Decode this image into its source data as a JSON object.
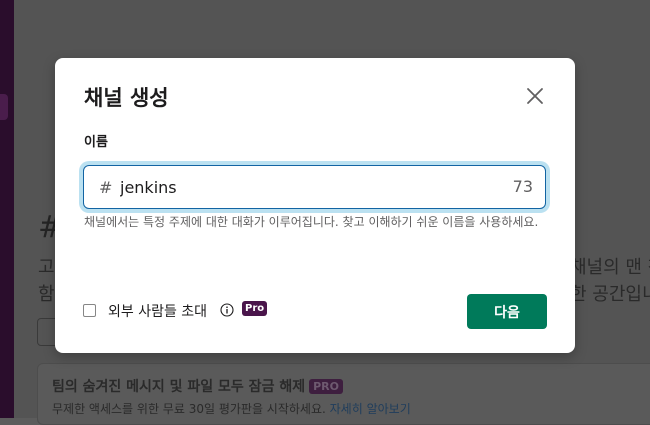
{
  "background": {
    "hash_glyph": "#",
    "left_line_1": "고",
    "left_line_2": "함",
    "right_line_1": "채널의 맨 첫",
    "right_line_2": "한 공간입니",
    "banner": {
      "title": "팀의 숨겨진 메시지 및 파일 모두 잠금 해제",
      "badge": "PRO",
      "subtitle": "무제한 액세스를 위한 무료 30일 평가판을 시작하세요.",
      "link": "자세히 알아보기"
    }
  },
  "modal": {
    "title": "채널 생성",
    "name_label": "이름",
    "prefix": "#",
    "input_value": "jenkins",
    "counter": "73",
    "help_text": "채널에서는 특정 주제에 대한 대화가 이루어집니다. 찾고 이해하기 쉬운 이름을 사용하세요.",
    "external_label": "외부 사람들 초대",
    "pro_badge": "Pro",
    "next_button": "다음"
  },
  "colors": {
    "primary_button": "#007a5a",
    "pro_badge": "#4a154b",
    "focus_border": "#1264a3"
  }
}
